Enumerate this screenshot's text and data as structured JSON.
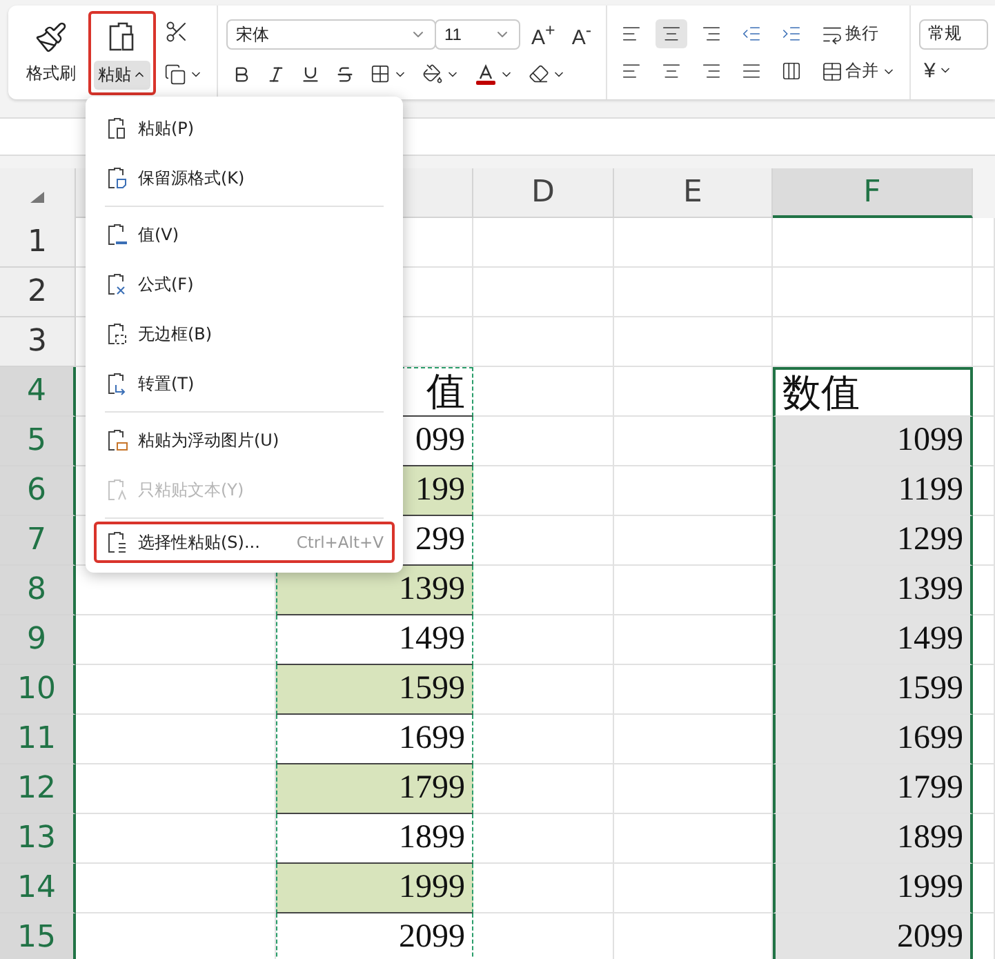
{
  "ribbon": {
    "clipboard": [
      {
        "kind": "brush",
        "label": "格式刷",
        "pressed": false,
        "outlined": false
      },
      {
        "kind": "paste",
        "label": "粘贴",
        "pressed": true,
        "outlined": true
      }
    ],
    "font": {
      "name": "宋体",
      "size": "11"
    },
    "font_size_buttons": [
      "A$^{+}$",
      "A$^{-}$"
    ],
    "vertical_align": [
      {
        "selected": false
      },
      {
        "selected": true
      },
      {
        "selected": false
      }
    ],
    "wrap_label": "换行",
    "merge_label": "合并",
    "number_format": "常规",
    "currency": "¥"
  },
  "paste_menu": {
    "groups": [
      [
        {
          "kind": "paste",
          "label": "粘贴(P)",
          "disabled": false,
          "outlined": false
        },
        {
          "kind": "keep",
          "label": "保留源格式(K)",
          "disabled": false,
          "outlined": false
        }
      ],
      [
        {
          "kind": "values",
          "label": "值(V)",
          "disabled": false,
          "outlined": false
        },
        {
          "kind": "formula",
          "label": "公式(F)",
          "disabled": false,
          "outlined": false
        },
        {
          "kind": "noborder",
          "label": "无边框(B)",
          "disabled": false,
          "outlined": false
        },
        {
          "kind": "transpose",
          "label": "转置(T)",
          "disabled": false,
          "outlined": false
        }
      ],
      [
        {
          "kind": "picture",
          "label": "粘贴为浮动图片(U)",
          "disabled": false,
          "outlined": false
        },
        {
          "kind": "text",
          "label": "只粘贴文本(Y)",
          "disabled": true,
          "outlined": false
        }
      ],
      [
        {
          "kind": "special",
          "label": "选择性粘贴(S)...",
          "shortcut": "Ctrl+Alt+V",
          "disabled": false,
          "outlined": true
        }
      ]
    ]
  },
  "column_headers": [
    {
      "label": "D",
      "selected": false
    },
    {
      "label": "E",
      "selected": false
    },
    {
      "label": "F",
      "selected": true
    }
  ],
  "rows": [
    {
      "number": "1",
      "selected": false,
      "c": {
        "copied": false,
        "shaded": false
      },
      "f": {
        "selected": false,
        "shaded": false
      }
    },
    {
      "number": "2",
      "selected": false,
      "c": {
        "copied": false,
        "shaded": false
      },
      "f": {
        "selected": false,
        "shaded": false
      }
    },
    {
      "number": "3",
      "selected": false,
      "c": {
        "copied": false,
        "shaded": false
      },
      "f": {
        "selected": false,
        "shaded": false
      }
    },
    {
      "number": "4",
      "selected": true,
      "c": {
        "text": "值",
        "kind": "label",
        "copied": true,
        "shaded": false
      },
      "f": {
        "text": "数值",
        "kind": "label",
        "selected": true,
        "shaded": false
      }
    },
    {
      "number": "5",
      "selected": true,
      "c": {
        "text": "099",
        "kind": "number",
        "copied": true,
        "shaded": false
      },
      "f": {
        "text": "1099",
        "kind": "number",
        "selected": true,
        "shaded": true
      }
    },
    {
      "number": "6",
      "selected": true,
      "c": {
        "text": "199",
        "kind": "number",
        "copied": true,
        "shaded": true
      },
      "f": {
        "text": "1199",
        "kind": "number",
        "selected": true,
        "shaded": true
      }
    },
    {
      "number": "7",
      "selected": true,
      "c": {
        "text": "299",
        "kind": "number",
        "copied": true,
        "shaded": false
      },
      "f": {
        "text": "1299",
        "kind": "number",
        "selected": true,
        "shaded": true
      }
    },
    {
      "number": "8",
      "selected": true,
      "c": {
        "text": "1399",
        "kind": "number",
        "copied": true,
        "shaded": true
      },
      "f": {
        "text": "1399",
        "kind": "number",
        "selected": true,
        "shaded": true
      }
    },
    {
      "number": "9",
      "selected": true,
      "c": {
        "text": "1499",
        "kind": "number",
        "copied": true,
        "shaded": false
      },
      "f": {
        "text": "1499",
        "kind": "number",
        "selected": true,
        "shaded": true
      }
    },
    {
      "number": "10",
      "selected": true,
      "c": {
        "text": "1599",
        "kind": "number",
        "copied": true,
        "shaded": true
      },
      "f": {
        "text": "1599",
        "kind": "number",
        "selected": true,
        "shaded": true
      }
    },
    {
      "number": "11",
      "selected": true,
      "c": {
        "text": "1699",
        "kind": "number",
        "copied": true,
        "shaded": false
      },
      "f": {
        "text": "1699",
        "kind": "number",
        "selected": true,
        "shaded": true
      }
    },
    {
      "number": "12",
      "selected": true,
      "c": {
        "text": "1799",
        "kind": "number",
        "copied": true,
        "shaded": true
      },
      "f": {
        "text": "1799",
        "kind": "number",
        "selected": true,
        "shaded": true
      }
    },
    {
      "number": "13",
      "selected": true,
      "c": {
        "text": "1899",
        "kind": "number",
        "copied": true,
        "shaded": false
      },
      "f": {
        "text": "1899",
        "kind": "number",
        "selected": true,
        "shaded": true
      }
    },
    {
      "number": "14",
      "selected": true,
      "c": {
        "text": "1999",
        "kind": "number",
        "copied": true,
        "shaded": true
      },
      "f": {
        "text": "1999",
        "kind": "number",
        "selected": true,
        "shaded": true
      }
    },
    {
      "number": "15",
      "selected": true,
      "c": {
        "text": "2099",
        "kind": "number",
        "copied": true,
        "shaded": false
      },
      "f": {
        "text": "2099",
        "kind": "number",
        "selected": true,
        "shaded": true
      }
    }
  ]
}
